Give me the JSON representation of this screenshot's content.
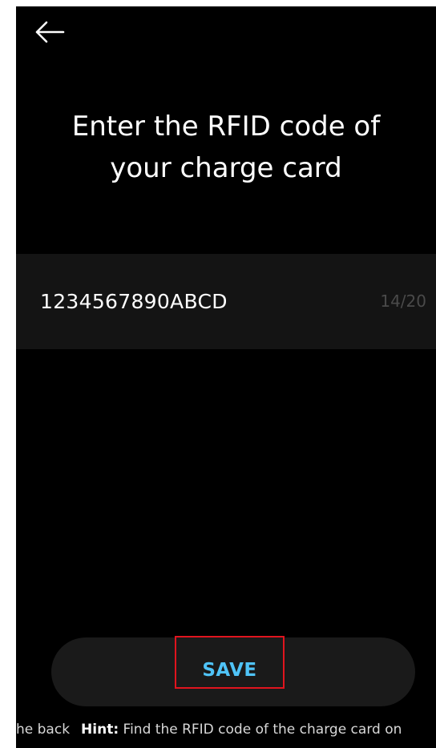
{
  "header": {
    "back_icon": "arrow-left-icon"
  },
  "main": {
    "title": "Enter the RFID code of\nyour charge card",
    "rfid_input": {
      "value": "1234567890ABCD",
      "counter": "14/20"
    }
  },
  "footer": {
    "save_label": "SAVE",
    "hint_lead": "he back",
    "hint_label": "Hint:",
    "hint_text": " Find the RFID code of the charge card on"
  },
  "colors": {
    "background": "#000000",
    "accent": "#4fc3f7",
    "highlight_border": "#e0141e"
  }
}
